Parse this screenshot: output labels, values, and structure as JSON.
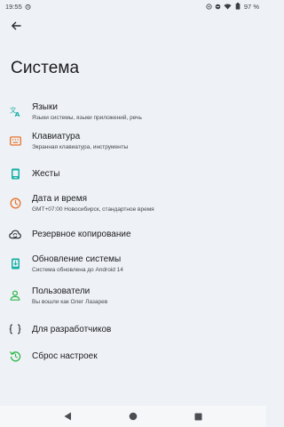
{
  "status_bar": {
    "time": "19:55",
    "battery": "97 %"
  },
  "header": {
    "back_icon": "arrow-back-icon",
    "title": "Система"
  },
  "colors": {
    "background": "#eef1f5",
    "teal": "#14b0a6",
    "orange": "#e8732c",
    "green": "#2fb84a",
    "dark": "#2b2e33"
  },
  "settings": [
    {
      "title": "Языки",
      "subtitle": "Языки системы, языки приложений, речь",
      "icon": "translate-icon"
    },
    {
      "title": "Клавиатура",
      "subtitle": "Экранная клавиатура, инструменты",
      "icon": "keyboard-icon"
    },
    {
      "title": "Жесты",
      "subtitle": "",
      "icon": "gesture-phone-icon"
    },
    {
      "title": "Дата и время",
      "subtitle": "GMT+07:00 Новосибирск, стандартное время",
      "icon": "clock-icon"
    },
    {
      "title": "Резервное копирование",
      "subtitle": "",
      "icon": "cloud-sync-icon"
    },
    {
      "title": "Обновление системы",
      "subtitle": "Система обновлена до Android 14",
      "icon": "system-update-icon"
    },
    {
      "title": "Пользователи",
      "subtitle": "Вы вошли как Олег Лазарев",
      "icon": "person-icon"
    },
    {
      "title": "Для разработчиков",
      "subtitle": "",
      "icon": "code-braces-icon"
    },
    {
      "title": "Сброс настроек",
      "subtitle": "",
      "icon": "reset-history-icon"
    }
  ],
  "nav_bar": {
    "back": "nav-back-icon",
    "home": "nav-home-icon",
    "recents": "nav-recents-icon"
  }
}
